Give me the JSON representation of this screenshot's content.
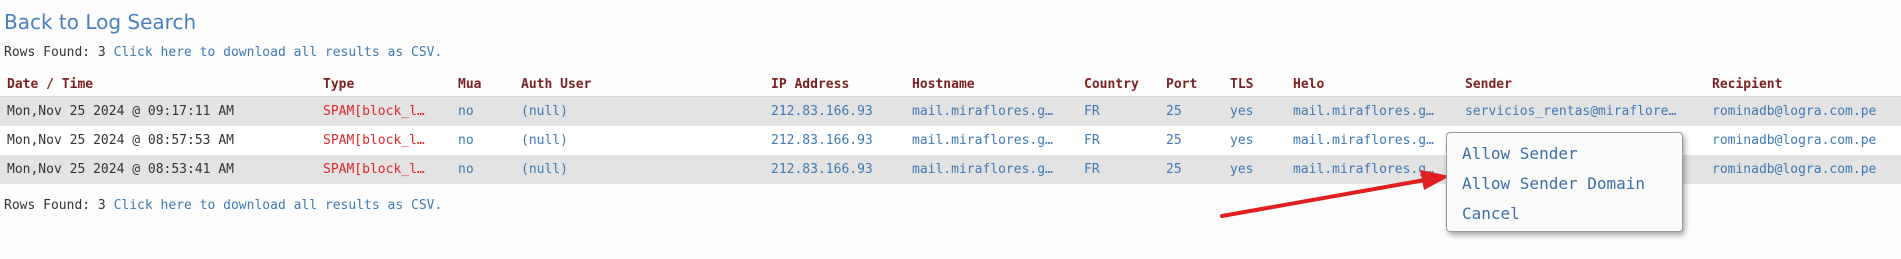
{
  "header": {
    "back_link": "Back to Log Search"
  },
  "summary": {
    "rows_found_label": "Rows Found: 3",
    "download_link": "Click here to download all results as CSV."
  },
  "table": {
    "columns": [
      "Date / Time",
      "Type",
      "Mua",
      "Auth User",
      "IP Address",
      "Hostname",
      "Country",
      "Port",
      "TLS",
      "Helo",
      "Sender",
      "Recipient"
    ],
    "rows": [
      {
        "date": "Mon,Nov 25 2024 @ 09:17:11 AM",
        "type": "SPAM[block_l…",
        "mua": "no",
        "auth": "(null)",
        "ip": "212.83.166.93",
        "hostname": "mail.miraflores.g…",
        "country": "FR",
        "port": "25",
        "tls": "yes",
        "helo": "mail.miraflores.g…",
        "sender": "servicios_rentas@miraflore…",
        "recipient": "rominadb@logra.com.pe"
      },
      {
        "date": "Mon,Nov 25 2024 @ 08:57:53 AM",
        "type": "SPAM[block_l…",
        "mua": "no",
        "auth": "(null)",
        "ip": "212.83.166.93",
        "hostname": "mail.miraflores.g…",
        "country": "FR",
        "port": "25",
        "tls": "yes",
        "helo": "mail.miraflores.g…",
        "sender": "",
        "recipient": "rominadb@logra.com.pe"
      },
      {
        "date": "Mon,Nov 25 2024 @ 08:53:41 AM",
        "type": "SPAM[block_l…",
        "mua": "no",
        "auth": "(null)",
        "ip": "212.83.166.93",
        "hostname": "mail.miraflores.g…",
        "country": "FR",
        "port": "25",
        "tls": "yes",
        "helo": "mail.miraflores.g…",
        "sender": "",
        "recipient": "rominadb@logra.com.pe"
      }
    ]
  },
  "context_menu": {
    "items": [
      "Allow Sender",
      "Allow Sender Domain",
      "Cancel"
    ]
  },
  "annotation": {
    "arrow_color": "#e02020"
  }
}
